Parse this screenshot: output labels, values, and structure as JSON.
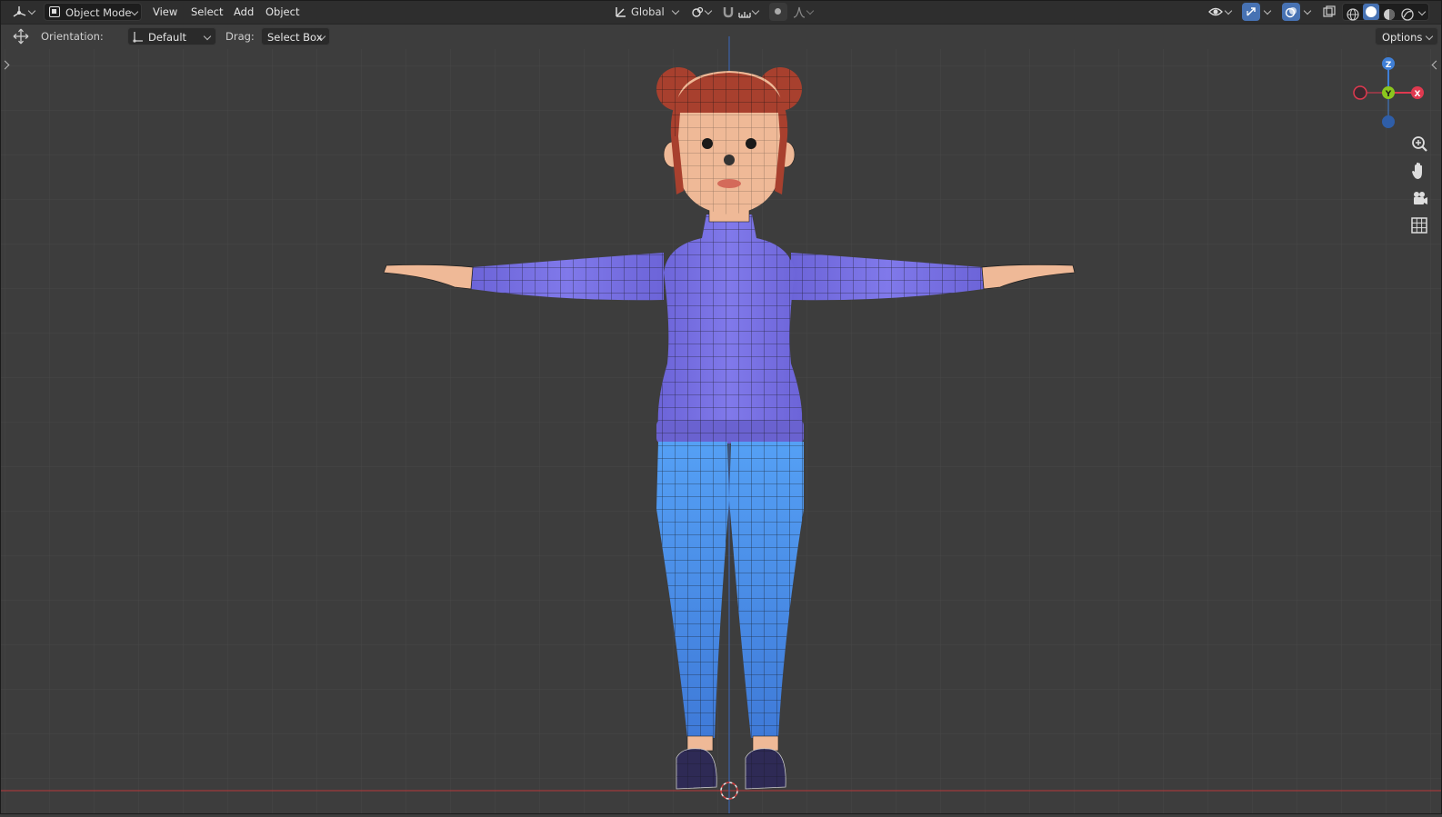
{
  "header": {
    "editor_type_icon": "editor-type-3d-viewport-icon",
    "mode": "Object Mode",
    "menus": [
      "View",
      "Select",
      "Add",
      "Object"
    ],
    "transform_orientation": "Global",
    "pivot_icon": "pivot-point-icon",
    "snap_icon": "snap-magnet-icon",
    "proportional_icon": "proportional-editing-icon",
    "right_icons": [
      "visibility-icon",
      "gizmo-icon",
      "overlay-icon",
      "xray-icon",
      "wireframe-shading-icon",
      "solid-shading-icon",
      "material-shading-icon",
      "rendered-shading-icon"
    ]
  },
  "tool_settings": {
    "orientation_label": "Orientation:",
    "orientation_value": "Default",
    "drag_label": "Drag:",
    "drag_value": "Select Box",
    "options_label": "Options"
  },
  "gizmo": {
    "axis_labels": [
      "Z",
      "Y",
      "X"
    ],
    "colors": {
      "x": "#e0394f",
      "y": "#8bc61e",
      "z": "#3f7fd6"
    }
  },
  "nav_icons": [
    "zoom-icon",
    "pan-hand-icon",
    "camera-icon",
    "perspective-grid-icon"
  ],
  "scene": {
    "colors": {
      "background": "#3d3d3d",
      "grid_line": "#484848",
      "x_axis": "#9a3a3a",
      "z_axis": "#3c62a8",
      "hair": "#a8402e",
      "skin": "#efb997",
      "sweater": "#7b73e6",
      "pants": "#4a8ee8",
      "shoes": "#2e2a55"
    }
  }
}
